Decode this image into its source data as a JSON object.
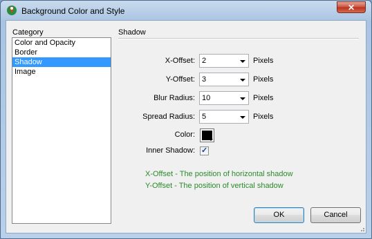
{
  "window": {
    "title": "Background Color and Style",
    "close_label": "✕"
  },
  "category": {
    "label": "Category",
    "items": [
      "Color and Opacity",
      "Border",
      "Shadow",
      "Image"
    ],
    "selected": "Shadow"
  },
  "section": {
    "title": "Shadow"
  },
  "fields": {
    "x_offset": {
      "label": "X-Offset:",
      "value": "2",
      "unit": "Pixels"
    },
    "y_offset": {
      "label": "Y-Offset:",
      "value": "3",
      "unit": "Pixels"
    },
    "blur_radius": {
      "label": "Blur Radius:",
      "value": "10",
      "unit": "Pixels"
    },
    "spread_radius": {
      "label": "Spread Radius:",
      "value": "5",
      "unit": "Pixels"
    },
    "color": {
      "label": "Color:",
      "value": "#000000"
    },
    "inner_shadow": {
      "label": "Inner Shadow:",
      "checked": true
    }
  },
  "help": {
    "line1": "X-Offset - The position of horizontal shadow",
    "line2": "Y-Offset - The position of vertical shadow",
    "color": "#2a8a2a"
  },
  "buttons": {
    "ok": "OK",
    "cancel": "Cancel"
  }
}
